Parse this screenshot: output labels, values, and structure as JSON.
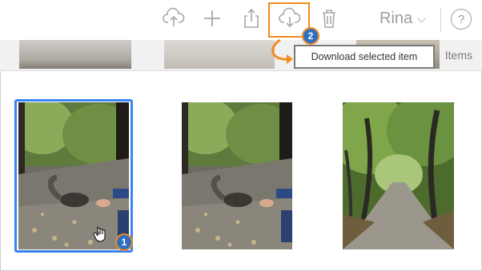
{
  "toolbar": {
    "icons": [
      "upload-cloud-icon",
      "plus-icon",
      "share-icon",
      "download-cloud-icon",
      "trash-icon",
      "help-icon"
    ],
    "user_name": "Rina",
    "help_glyph": "?"
  },
  "strip": {
    "items_label": "Items"
  },
  "tooltip": {
    "text": "Download selected item"
  },
  "badges": {
    "step1": "1",
    "step2": "2"
  },
  "photos": [
    {
      "subject": "squirrel on forest path",
      "selected": true
    },
    {
      "subject": "squirrel on forest path",
      "selected": false
    },
    {
      "subject": "tree-lined forest path",
      "selected": false
    }
  ],
  "colors": {
    "accent_orange": "#f28b1e",
    "selection_blue": "#3a84f2",
    "badge_blue": "#2f6fc0",
    "icon_gray": "#a7a7a7"
  }
}
